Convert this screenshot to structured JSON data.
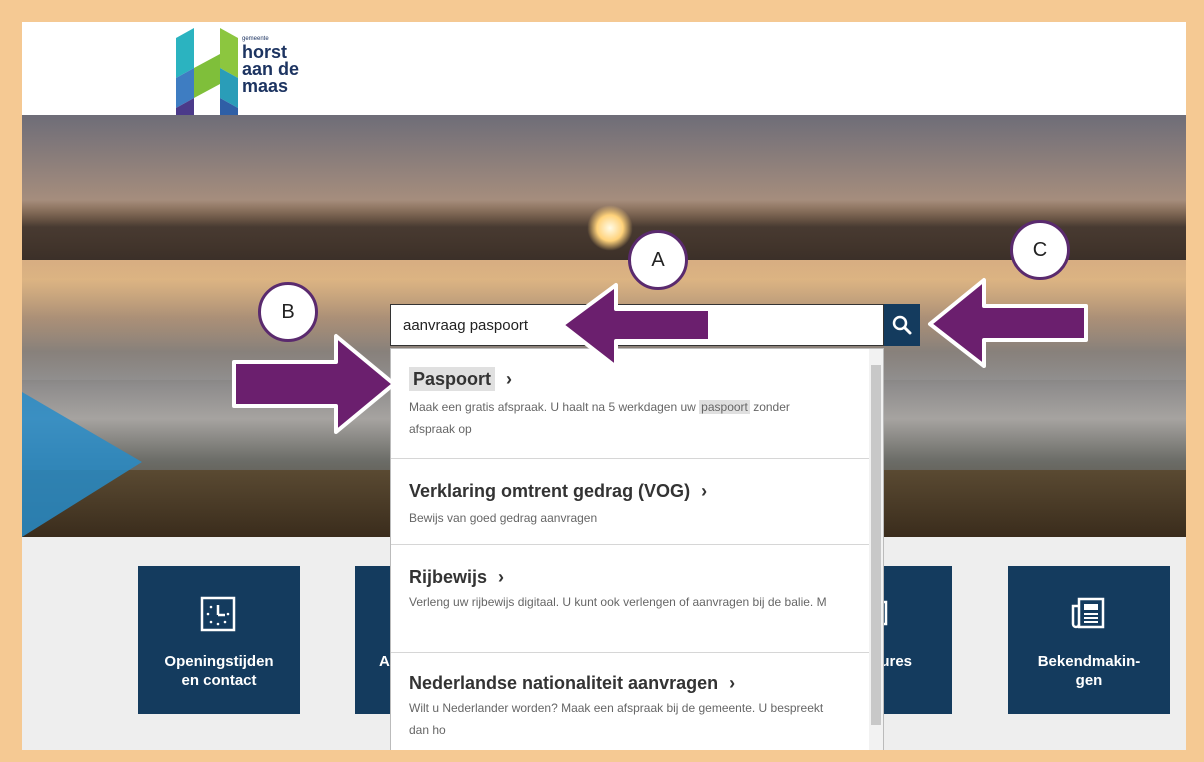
{
  "logo": {
    "small_text": "gemeente",
    "line1": "horst",
    "line2": "aan de",
    "line3": "maas"
  },
  "search": {
    "value": "aanvraag paspoort",
    "button_icon": "search-icon"
  },
  "suggestions": [
    {
      "title": "Paspoort",
      "desc_before": "Maak een gratis afspraak. U haalt na 5 werkdagen uw ",
      "desc_highlight": "paspoort",
      "desc_after": " zonder afspraak op"
    },
    {
      "title": "Verklaring omtrent gedrag (VOG)",
      "desc": "Bewijs van goed gedrag aanvragen"
    },
    {
      "title": "Rijbewijs",
      "desc": "Verleng uw rijbewijs digitaal. U kunt ook verlengen of aanvragen bij de balie. M"
    },
    {
      "title": "Nederlandse nationaliteit aanvragen",
      "desc": "Wilt u Nederlander worden? Maak een afspraak bij de gemeente. U bespreekt dan ho"
    }
  ],
  "chevron": "›",
  "tiles": [
    {
      "line1": "Openingstijden",
      "line2": "en contact",
      "icon": "clock-icon"
    },
    {
      "line1": "A",
      "line2": "",
      "icon": ""
    },
    {
      "line1": "ures",
      "line2": "",
      "icon": "brochure-icon"
    },
    {
      "line1": "Bekendmakin-",
      "line2": "gen",
      "icon": "newspaper-icon"
    }
  ],
  "annotations": {
    "a": "A",
    "b": "B",
    "c": "C"
  },
  "colors": {
    "arrow": "#6b1f6e",
    "tile": "#143b5e",
    "frame": "#f5c993"
  }
}
